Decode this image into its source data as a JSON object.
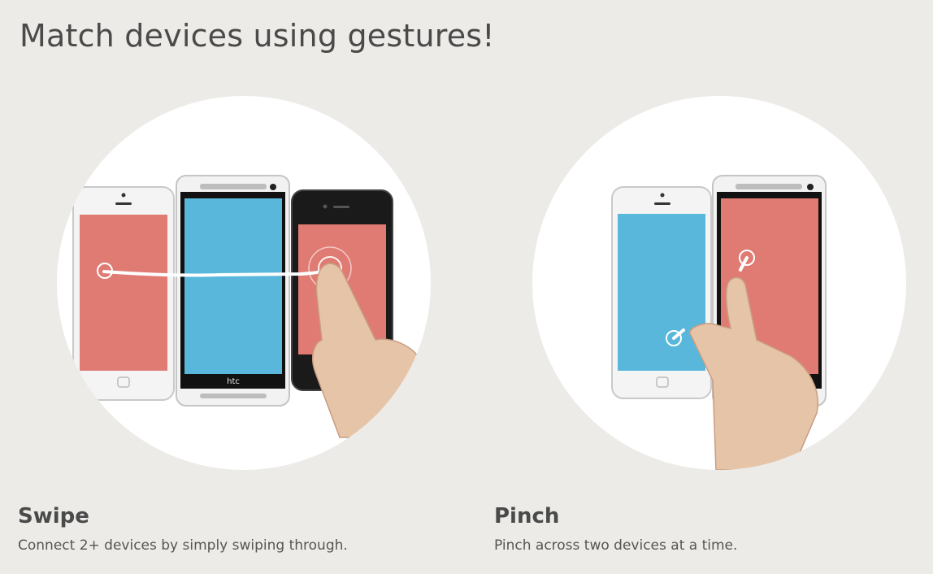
{
  "page": {
    "title": "Match devices using gestures!"
  },
  "features": [
    {
      "title": "Swipe",
      "description": "Connect 2+ devices by simply swiping through.",
      "screen_colors": [
        "#e07b73",
        "#58b7db",
        "#e07b73"
      ],
      "brand_label": "htc"
    },
    {
      "title": "Pinch",
      "description": "Pinch across two devices at a time.",
      "screen_colors": [
        "#58b7db",
        "#e07b73"
      ]
    }
  ],
  "colors": {
    "background": "#ecebe7",
    "coral": "#e07b73",
    "blue": "#58b7db",
    "text": "#4a4a4a"
  }
}
